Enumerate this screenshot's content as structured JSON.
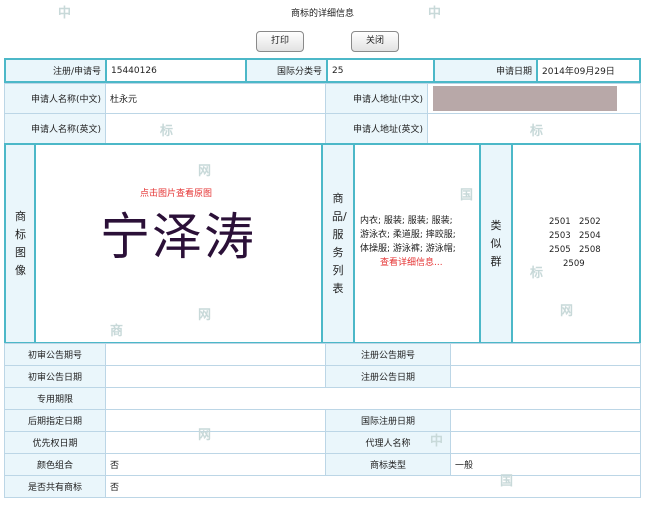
{
  "page_title": "商标的详细信息",
  "buttons": {
    "print": "打印",
    "close": "关闭"
  },
  "row1": {
    "reg_no_label": "注册/申请号",
    "reg_no": "15440126",
    "class_label": "国际分类号",
    "class_no": "25",
    "app_date_label": "申请日期",
    "app_date": "2014年09月29日"
  },
  "applicant": {
    "name_cn_label": "申请人名称(中文)",
    "name_cn": "杜永元",
    "addr_cn_label": "申请人地址(中文)",
    "name_en_label": "申请人名称(英文)",
    "addr_en_label": "申请人地址(英文)"
  },
  "image_section": {
    "label": "商标图像",
    "click_hint": "点击图片查看原图",
    "trademark_text": "宁泽涛"
  },
  "goods_section": {
    "label": "商品/服务列表",
    "goods_lines": [
      "内衣; 服装; 服装; 服装;",
      "游泳衣; 柔道服; 摔跤服;",
      "体操服; 游泳裤; 游泳帽;"
    ],
    "more_link": "查看详细信息..."
  },
  "similar_section": {
    "label": "类似群",
    "groups": [
      [
        "2501",
        "2502"
      ],
      [
        "2503",
        "2504"
      ],
      [
        "2505",
        "2508"
      ],
      [
        "2509"
      ]
    ]
  },
  "details": {
    "prelim_pub_no_label": "初审公告期号",
    "reg_pub_no_label": "注册公告期号",
    "prelim_pub_date_label": "初审公告日期",
    "reg_pub_date_label": "注册公告日期",
    "exclusive_period_label": "专用期限",
    "later_designation_label": "后期指定日期",
    "intl_reg_date_label": "国际注册日期",
    "priority_date_label": "优先权日期",
    "agent_label": "代理人名称",
    "color_combo_label": "颜色组合",
    "color_combo": "否",
    "tm_type_label": "商标类型",
    "tm_type": "一般",
    "shared_label": "是否共有商标",
    "shared": "否"
  },
  "watermarks": [
    "中",
    "国",
    "商",
    "标",
    "网"
  ]
}
